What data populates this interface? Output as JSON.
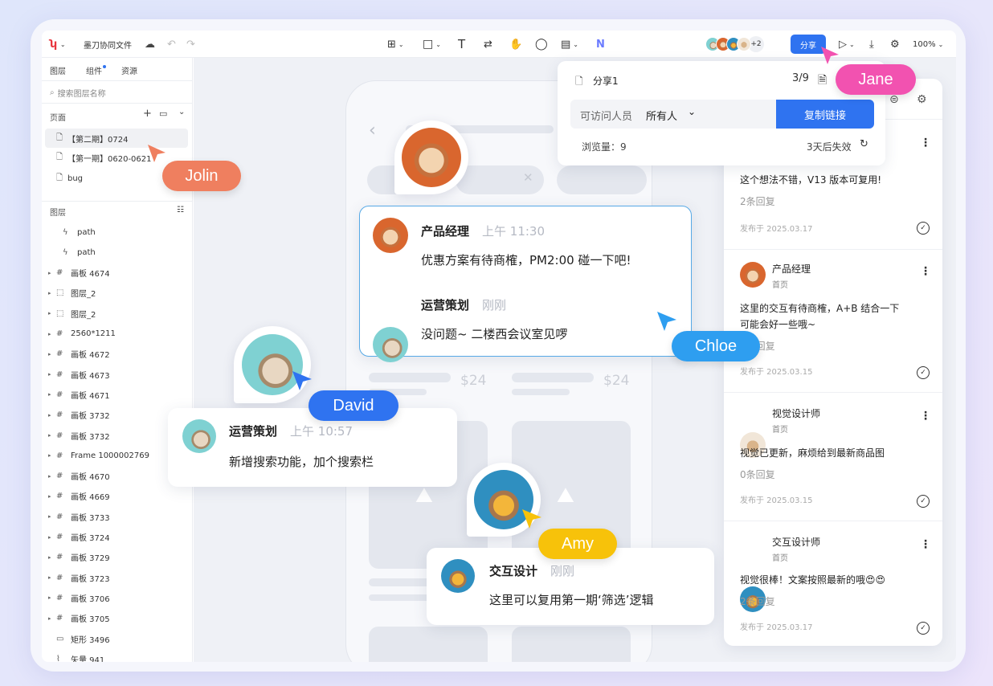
{
  "app": {
    "title": "墨刀协同文件",
    "zoom": "100%",
    "share_label": "分享",
    "collab_more": "+2"
  },
  "sidebar": {
    "tabs": [
      "图层",
      "组件",
      "资源"
    ],
    "search_placeholder": "搜索图层名称",
    "pages_title": "页面",
    "pages": [
      "【第二期】0724",
      "【第一期】0620-0621",
      "bug"
    ],
    "layers_title": "图层",
    "layers": [
      "path",
      "path",
      "画板 4674",
      "图层_2",
      "图层_2",
      "2560*1211",
      "画板 4672",
      "画板 4673",
      "画板 4671",
      "画板 3732",
      "画板 3732",
      "Frame 1000002769",
      "画板 4670",
      "画板 4669",
      "画板 3733",
      "画板 3724",
      "画板 3729",
      "画板 3723",
      "画板 3706",
      "画板 3705",
      "矩形 3496",
      "矢量 941"
    ]
  },
  "share_popup": {
    "name": "分享1",
    "count": "3/9",
    "access_label": "可访问人员",
    "access_value": "所有人",
    "copy_button": "复制链接",
    "views": "浏览量：9",
    "expiry": "3天后失效"
  },
  "canvas": {
    "prices": [
      "$24",
      "$24"
    ],
    "comment_main": [
      {
        "name": "产品经理",
        "time": "上午 11:30",
        "text": "优惠方案有待商榷，PM2:00 碰一下吧!"
      },
      {
        "name": "运营策划",
        "time": "刚刚",
        "text": "没问题~ 二楼西会议室见啰"
      }
    ],
    "comment_david": {
      "name": "运营策划",
      "time": "上午 10:57",
      "text": "新增搜索功能，加个搜索栏"
    },
    "comment_amy": {
      "name": "交互设计",
      "time": "刚刚",
      "text": "这里可以复用第一期‘筛选’逻辑"
    }
  },
  "cursors": {
    "jolin": "Jolin",
    "jane": "Jane",
    "chloe": "Chloe",
    "david": "David",
    "amy": "Amy"
  },
  "colors": {
    "jolin": "#ef7f5f",
    "jane": "#f252b0",
    "chloe": "#2e9ef0",
    "david": "#2f73f0",
    "amy": "#f7c20a",
    "accent": "#2f73f0"
  },
  "right_panel": [
    {
      "name": "",
      "sub": "",
      "text": "这个想法不错，V13 版本可复用!",
      "reply": "2条回复",
      "date": "发布于 2025.03.17"
    },
    {
      "name": "产品经理",
      "sub": "首页",
      "text1": "这里的交互有待商榷，A+B 结合一下",
      "text2": "可能会好一些哦~",
      "reply": "0条回复",
      "date": "发布于 2025.03.15"
    },
    {
      "name": "视觉设计师",
      "sub": "首页",
      "text": "视觉已更新，麻烦给到最新商品图",
      "reply": "0条回复",
      "date": "发布于 2025.03.15"
    },
    {
      "name": "交互设计师",
      "sub": "首页",
      "text": "视觉很棒！文案按照最新的哦😍😍",
      "reply": "2条回复",
      "date": "发布于 2025.03.17"
    }
  ]
}
